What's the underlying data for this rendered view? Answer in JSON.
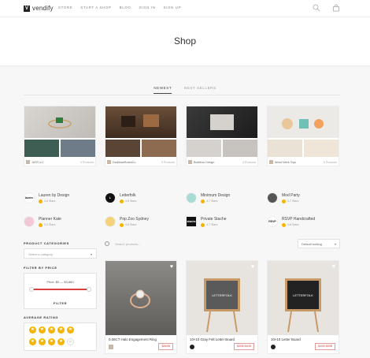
{
  "brand": {
    "name": "vendify",
    "mark": "V"
  },
  "nav": [
    "STORE",
    "START A SHOP",
    "BLOG",
    "SIGN IN",
    "SIGN UP"
  ],
  "header_icons": [
    "search-icon",
    "bag-icon"
  ],
  "page_title": "Shop",
  "tabs": [
    {
      "label": "NEWEST",
      "active": true
    },
    {
      "label": "BEST SELLERS",
      "active": false
    }
  ],
  "vendors_featured": [
    {
      "name": "JUSTLLC",
      "count": "4 Products"
    },
    {
      "name": "DarktownBoardCo",
      "count": "5 Products"
    },
    {
      "name": "Boldthou Design",
      "count": "4 Products"
    },
    {
      "name": "Wood Werk Toys",
      "count": "5 Products"
    }
  ],
  "vendor_list": [
    {
      "name": "Lauren by Design",
      "stars": "4.8 Stars",
      "logo_text": "lauren"
    },
    {
      "name": "Letterfolk",
      "stars": "4.8 Stars",
      "logo_text": "L"
    },
    {
      "name": "Minimum Design",
      "stars": "4.7 Stars",
      "logo_text": ""
    },
    {
      "name": "Mod Party",
      "stars": "4.7 Stars",
      "logo_text": ""
    },
    {
      "name": "Planner Kate",
      "stars": "5.0 Stars",
      "logo_text": ""
    },
    {
      "name": "Pop Zoo Sydney",
      "stars": "4.8 Stars",
      "logo_text": ""
    },
    {
      "name": "Private Stache",
      "stars": "4.7 Stars",
      "logo_text": "stache"
    },
    {
      "name": "RSVP Handcrafted",
      "stars": "4.8 Stars",
      "logo_text": "RSVP"
    }
  ],
  "sidebar": {
    "categories_heading": "PRODUCT CATEGORIES",
    "category_placeholder": "Select a category",
    "price_heading": "FILTER BY PRICE",
    "price_text": "Price: $0 — $3,860",
    "filter_label": "FILTER",
    "rating_heading": "AVERAGE RATING"
  },
  "search": {
    "placeholder": "Search products..."
  },
  "sort": {
    "value": "Default sorting"
  },
  "products": [
    {
      "name": "0.06CT Halo Engagement Ring",
      "price": "$860$"
    },
    {
      "name": "10×10 Gray Felt Letter Board",
      "price": "$45$ $60$"
    },
    {
      "name": "10×10 Letter Board",
      "price": "$45$ $60$"
    }
  ],
  "colors": {
    "accent": "#d9403b",
    "star": "#f5b400"
  }
}
